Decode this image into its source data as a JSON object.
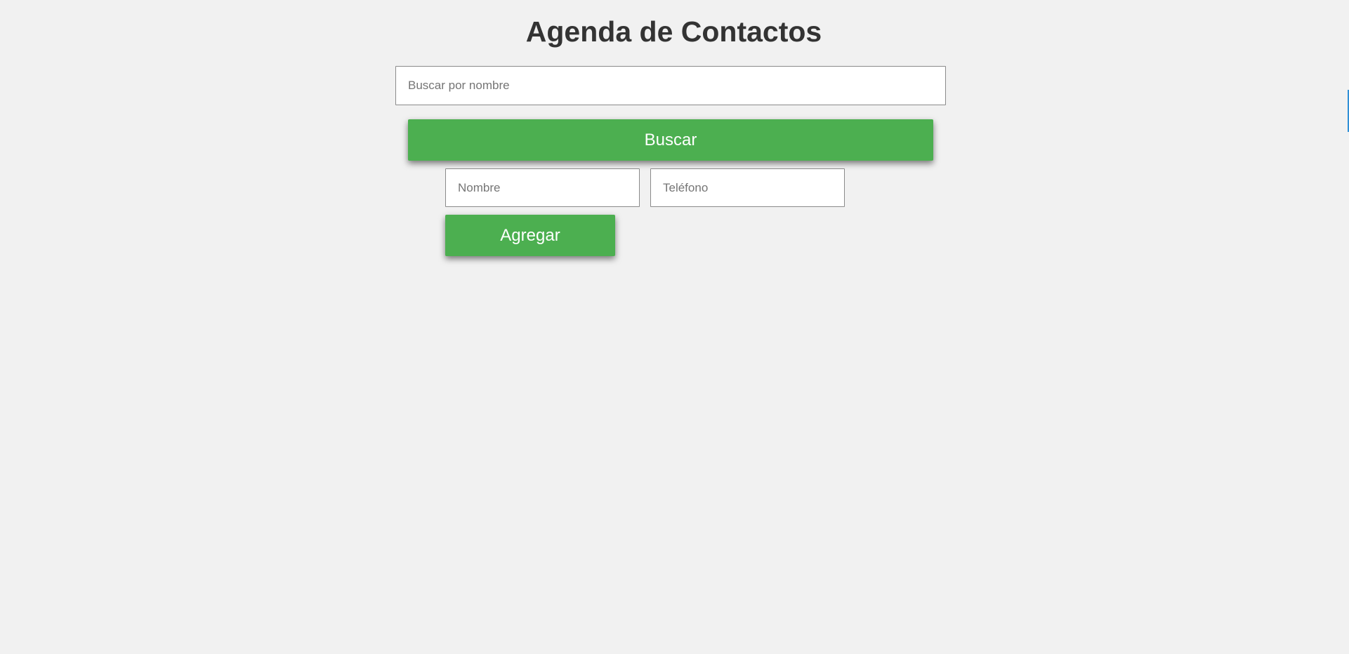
{
  "header": {
    "title": "Agenda de Contactos"
  },
  "search": {
    "placeholder": "Buscar por nombre",
    "value": "",
    "button_label": "Buscar"
  },
  "add_contact": {
    "name_placeholder": "Nombre",
    "name_value": "",
    "phone_placeholder": "Teléfono",
    "phone_value": "",
    "button_label": "Agregar"
  },
  "colors": {
    "background": "#f1f1f1",
    "button": "#4caf50",
    "button_text": "#ffffff",
    "title": "#333333"
  }
}
